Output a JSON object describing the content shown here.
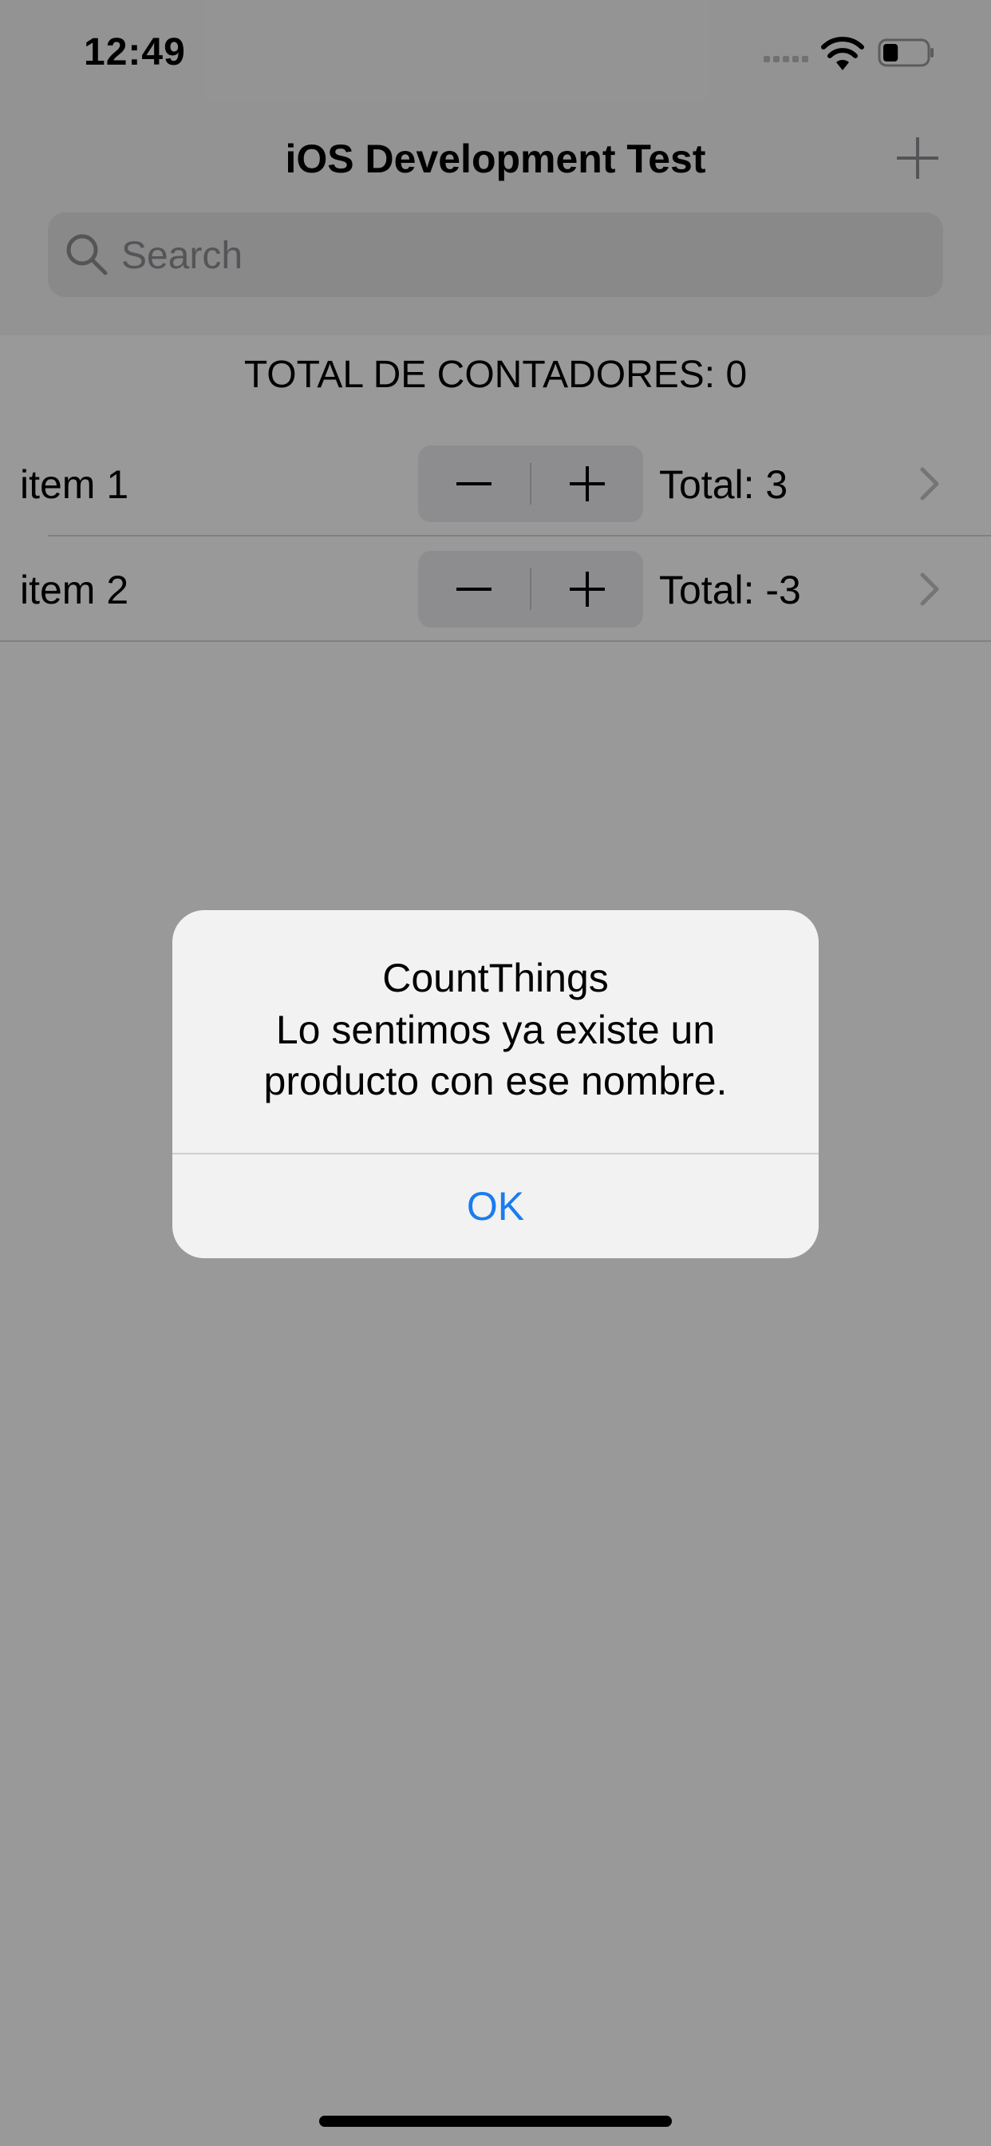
{
  "status_bar": {
    "time": "12:49",
    "signal_icon": "cellular-signal-icon",
    "wifi_icon": "wifi-icon",
    "battery_icon": "battery-icon",
    "battery_level": 0.35
  },
  "nav": {
    "title": "iOS Development Test",
    "add_icon": "plus-icon"
  },
  "search": {
    "placeholder": "Search",
    "value": "",
    "icon": "search-icon"
  },
  "summary": {
    "total_label": "TOTAL DE CONTADORES: 0"
  },
  "items": [
    {
      "name": "item 1",
      "total": "Total: 3"
    },
    {
      "name": "item 2",
      "total": "Total: -3"
    }
  ],
  "alert": {
    "title": "CountThings",
    "message": "Lo sentimos ya existe un producto con ese nombre.",
    "ok_label": "OK"
  },
  "colors": {
    "accent": "#1a7cf0",
    "overlay": "rgba(0,0,0,0.40)"
  }
}
